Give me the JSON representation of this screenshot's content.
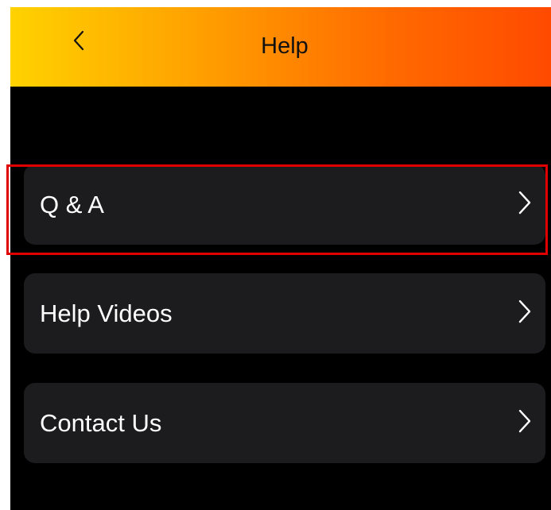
{
  "header": {
    "title": "Help",
    "back_icon": "chevron-left-icon"
  },
  "menu": {
    "items": [
      {
        "label": "Q & A",
        "icon": "chevron-right-icon"
      },
      {
        "label": "Help Videos",
        "icon": "chevron-right-icon"
      },
      {
        "label": "Contact Us",
        "icon": "chevron-right-icon"
      }
    ]
  },
  "colors": {
    "header_gradient_start": "#ffd200",
    "header_gradient_end": "#ff4a00",
    "background": "#000000",
    "card": "#1c1c1e",
    "highlight": "#e10000"
  }
}
